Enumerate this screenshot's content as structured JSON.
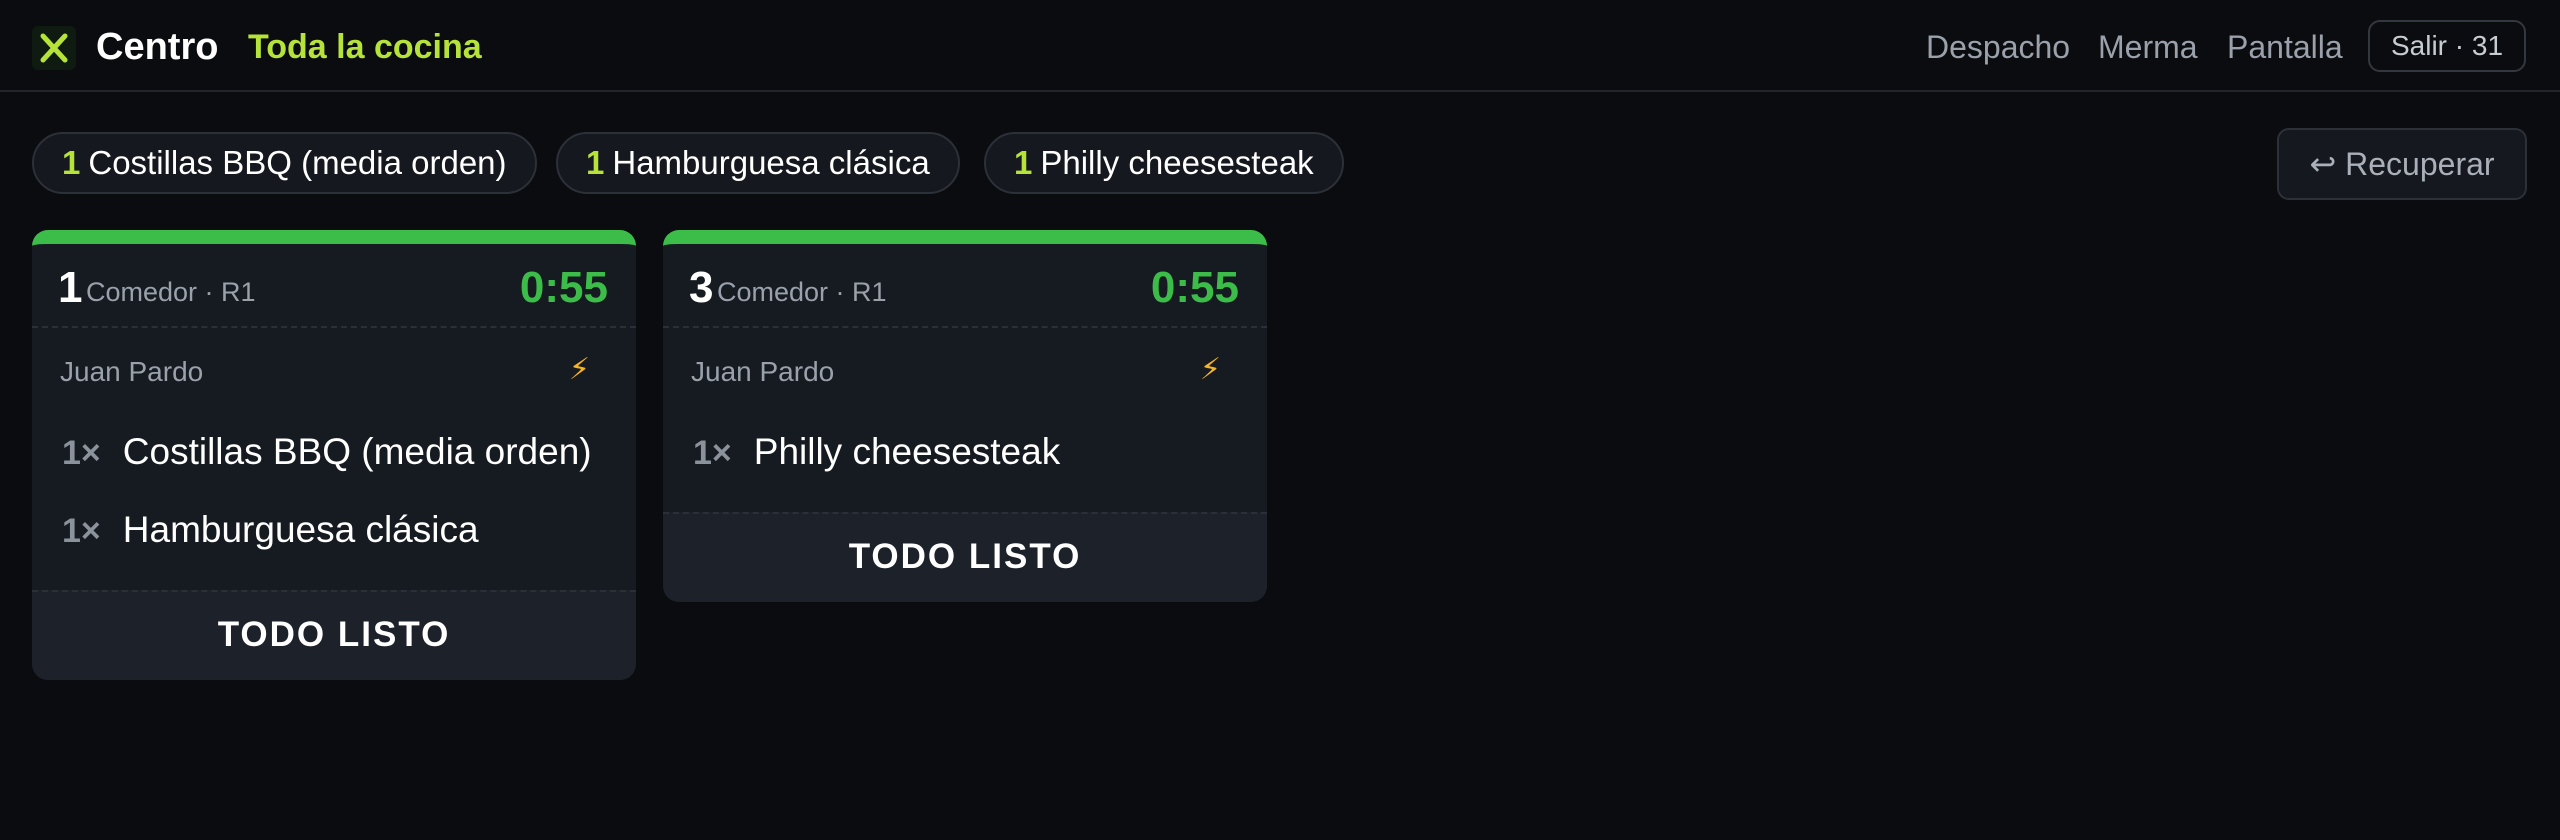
{
  "header": {
    "brand": "Centro",
    "station": "Toda la cocina",
    "nav": [
      "Despacho",
      "Merma",
      "Pantalla"
    ],
    "exit_label": "Salir · 31",
    "accent_color": "#b6e33a"
  },
  "summary_chips": [
    {
      "qty": "1",
      "name": "Costillas BBQ (media orden)"
    },
    {
      "qty": "1",
      "name": "Hamburguesa clásica"
    },
    {
      "qty": "1",
      "name": "Philly cheesesteak"
    }
  ],
  "recover_label": "↩ Recuperar",
  "tickets": [
    {
      "number": "1",
      "location": "Comedor · R1",
      "elapsed": "0:55",
      "server": "Juan Pardo",
      "priority_icon": "lightning-icon",
      "items": [
        {
          "qty": "1×",
          "name": "Costillas BBQ (media orden)"
        },
        {
          "qty": "1×",
          "name": "Hamburguesa clásica"
        }
      ],
      "done_label": "TODO LISTO",
      "status_color": "#3cbc48"
    },
    {
      "number": "3",
      "location": "Comedor · R1",
      "elapsed": "0:55",
      "server": "Juan Pardo",
      "priority_icon": "lightning-icon",
      "items": [
        {
          "qty": "1×",
          "name": "Philly cheesesteak"
        }
      ],
      "done_label": "TODO LISTO",
      "status_color": "#3cbc48"
    }
  ]
}
